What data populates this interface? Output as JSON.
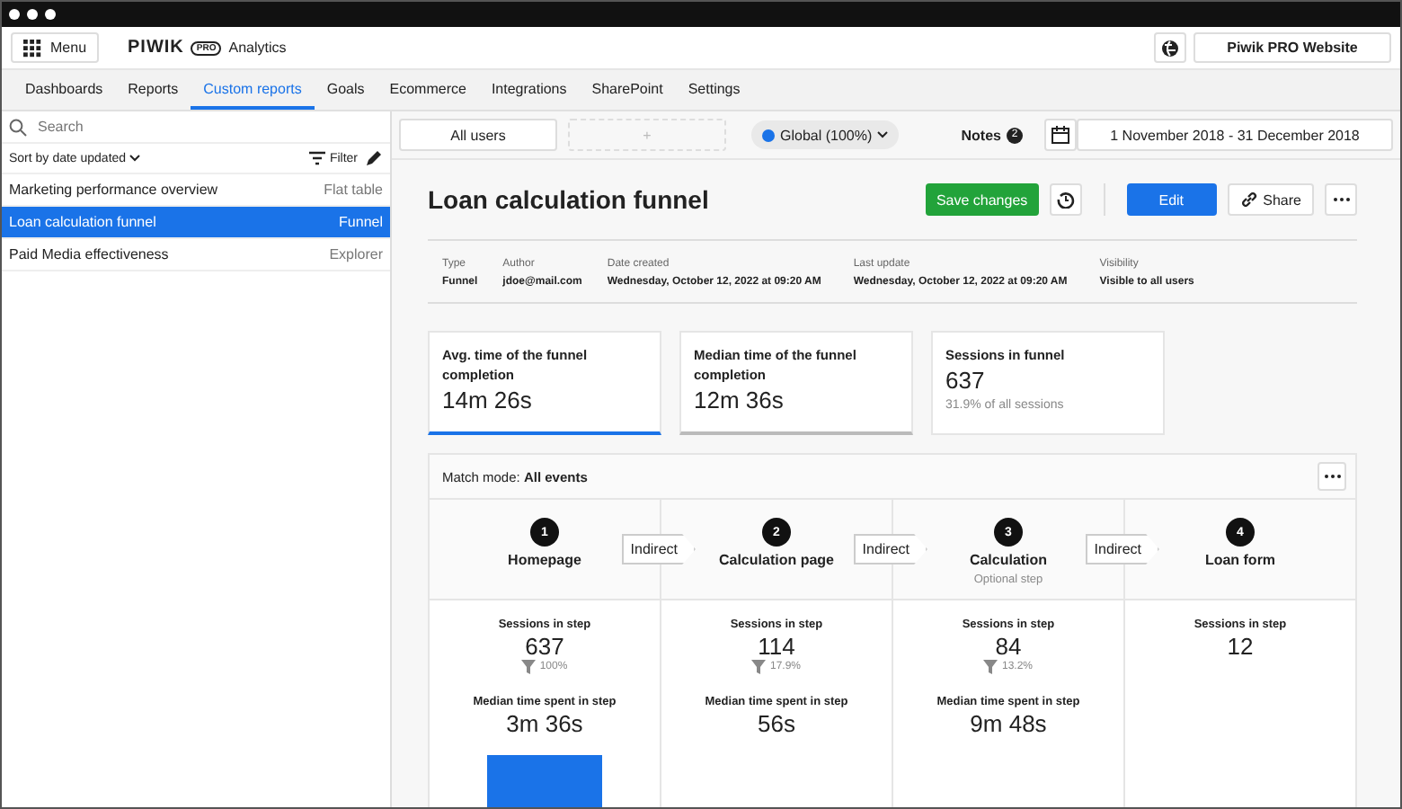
{
  "header": {
    "menu_label": "Menu",
    "logo": "PIWIK",
    "logo_badge": "PRO",
    "product": "Analytics",
    "website": "Piwik PRO Website"
  },
  "nav_tabs": [
    {
      "label": "Dashboards",
      "selected": false
    },
    {
      "label": "Reports",
      "selected": false
    },
    {
      "label": "Custom reports",
      "selected": true
    },
    {
      "label": "Goals",
      "selected": false
    },
    {
      "label": "Ecommerce",
      "selected": false
    },
    {
      "label": "Integrations",
      "selected": false
    },
    {
      "label": "SharePoint",
      "selected": false
    },
    {
      "label": "Settings",
      "selected": false
    }
  ],
  "sidebar": {
    "search": {
      "placeholder": "Search"
    },
    "sort_label": "Sort by",
    "sort_value": "date updated",
    "filter_label": "Filter",
    "items": [
      {
        "name": "Marketing performance overview",
        "type": "Flat table",
        "selected": false
      },
      {
        "name": "Loan calculation funnel",
        "type": "Funnel",
        "selected": true
      },
      {
        "name": "Paid Media effectiveness",
        "type": "Explorer",
        "selected": false
      }
    ]
  },
  "toolbar": {
    "segment": "All users",
    "add_segment": "+",
    "sampling": "Global (100%)",
    "notes_label": "Notes",
    "notes_count": "2",
    "date_range": "1 November 2018 - 31 December 2018"
  },
  "report": {
    "title": "Loan calculation funnel",
    "buttons": {
      "save": "Save changes",
      "edit": "Edit",
      "share": "Share"
    },
    "meta": [
      {
        "label": "Type",
        "value": "Funnel"
      },
      {
        "label": "Author",
        "value": "jdoe@mail.com"
      },
      {
        "label": "Date created",
        "value": "Wednesday, October 12, 2022 at 09:20 AM"
      },
      {
        "label": "Last update",
        "value": "Wednesday, October 12, 2022 at 09:20 AM"
      },
      {
        "label": "Visibility",
        "value": "Visible to all users"
      }
    ],
    "metrics": [
      {
        "label": "Avg. time of the funnel completion",
        "value": "14m 26s",
        "selected": true
      },
      {
        "label": "Median time of the funnel completion",
        "value": "12m 36s",
        "selected": false
      },
      {
        "label": "Sessions in funnel",
        "value": "637",
        "note": "31.9% of all sessions",
        "selected": false
      }
    ]
  },
  "funnel": {
    "match_label": "Match mode:",
    "match_value": "All events",
    "steps": [
      {
        "number": "1",
        "name": "Homepage",
        "connector": "Indirect",
        "sessions_label": "Sessions in step",
        "sessions": "637",
        "rate": "100%",
        "time_label": "Median time spent in step",
        "time": "3m 36s",
        "bar": true
      },
      {
        "number": "2",
        "name": "Calculation page",
        "connector": "Indirect",
        "sessions_label": "Sessions in step",
        "sessions": "114",
        "rate": "17.9%",
        "time_label": "Median time spent in step",
        "time": "56s",
        "bar": false
      },
      {
        "number": "3",
        "name": "Calculation",
        "note": "Optional step",
        "connector": "Indirect",
        "sessions_label": "Sessions in step",
        "sessions": "84",
        "rate": "13.2%",
        "time_label": "Median time spent in step",
        "time": "9m 48s",
        "bar": false
      },
      {
        "number": "4",
        "name": "Loan form",
        "sessions_label": "Sessions in step",
        "sessions": "12",
        "bar": false
      }
    ]
  }
}
